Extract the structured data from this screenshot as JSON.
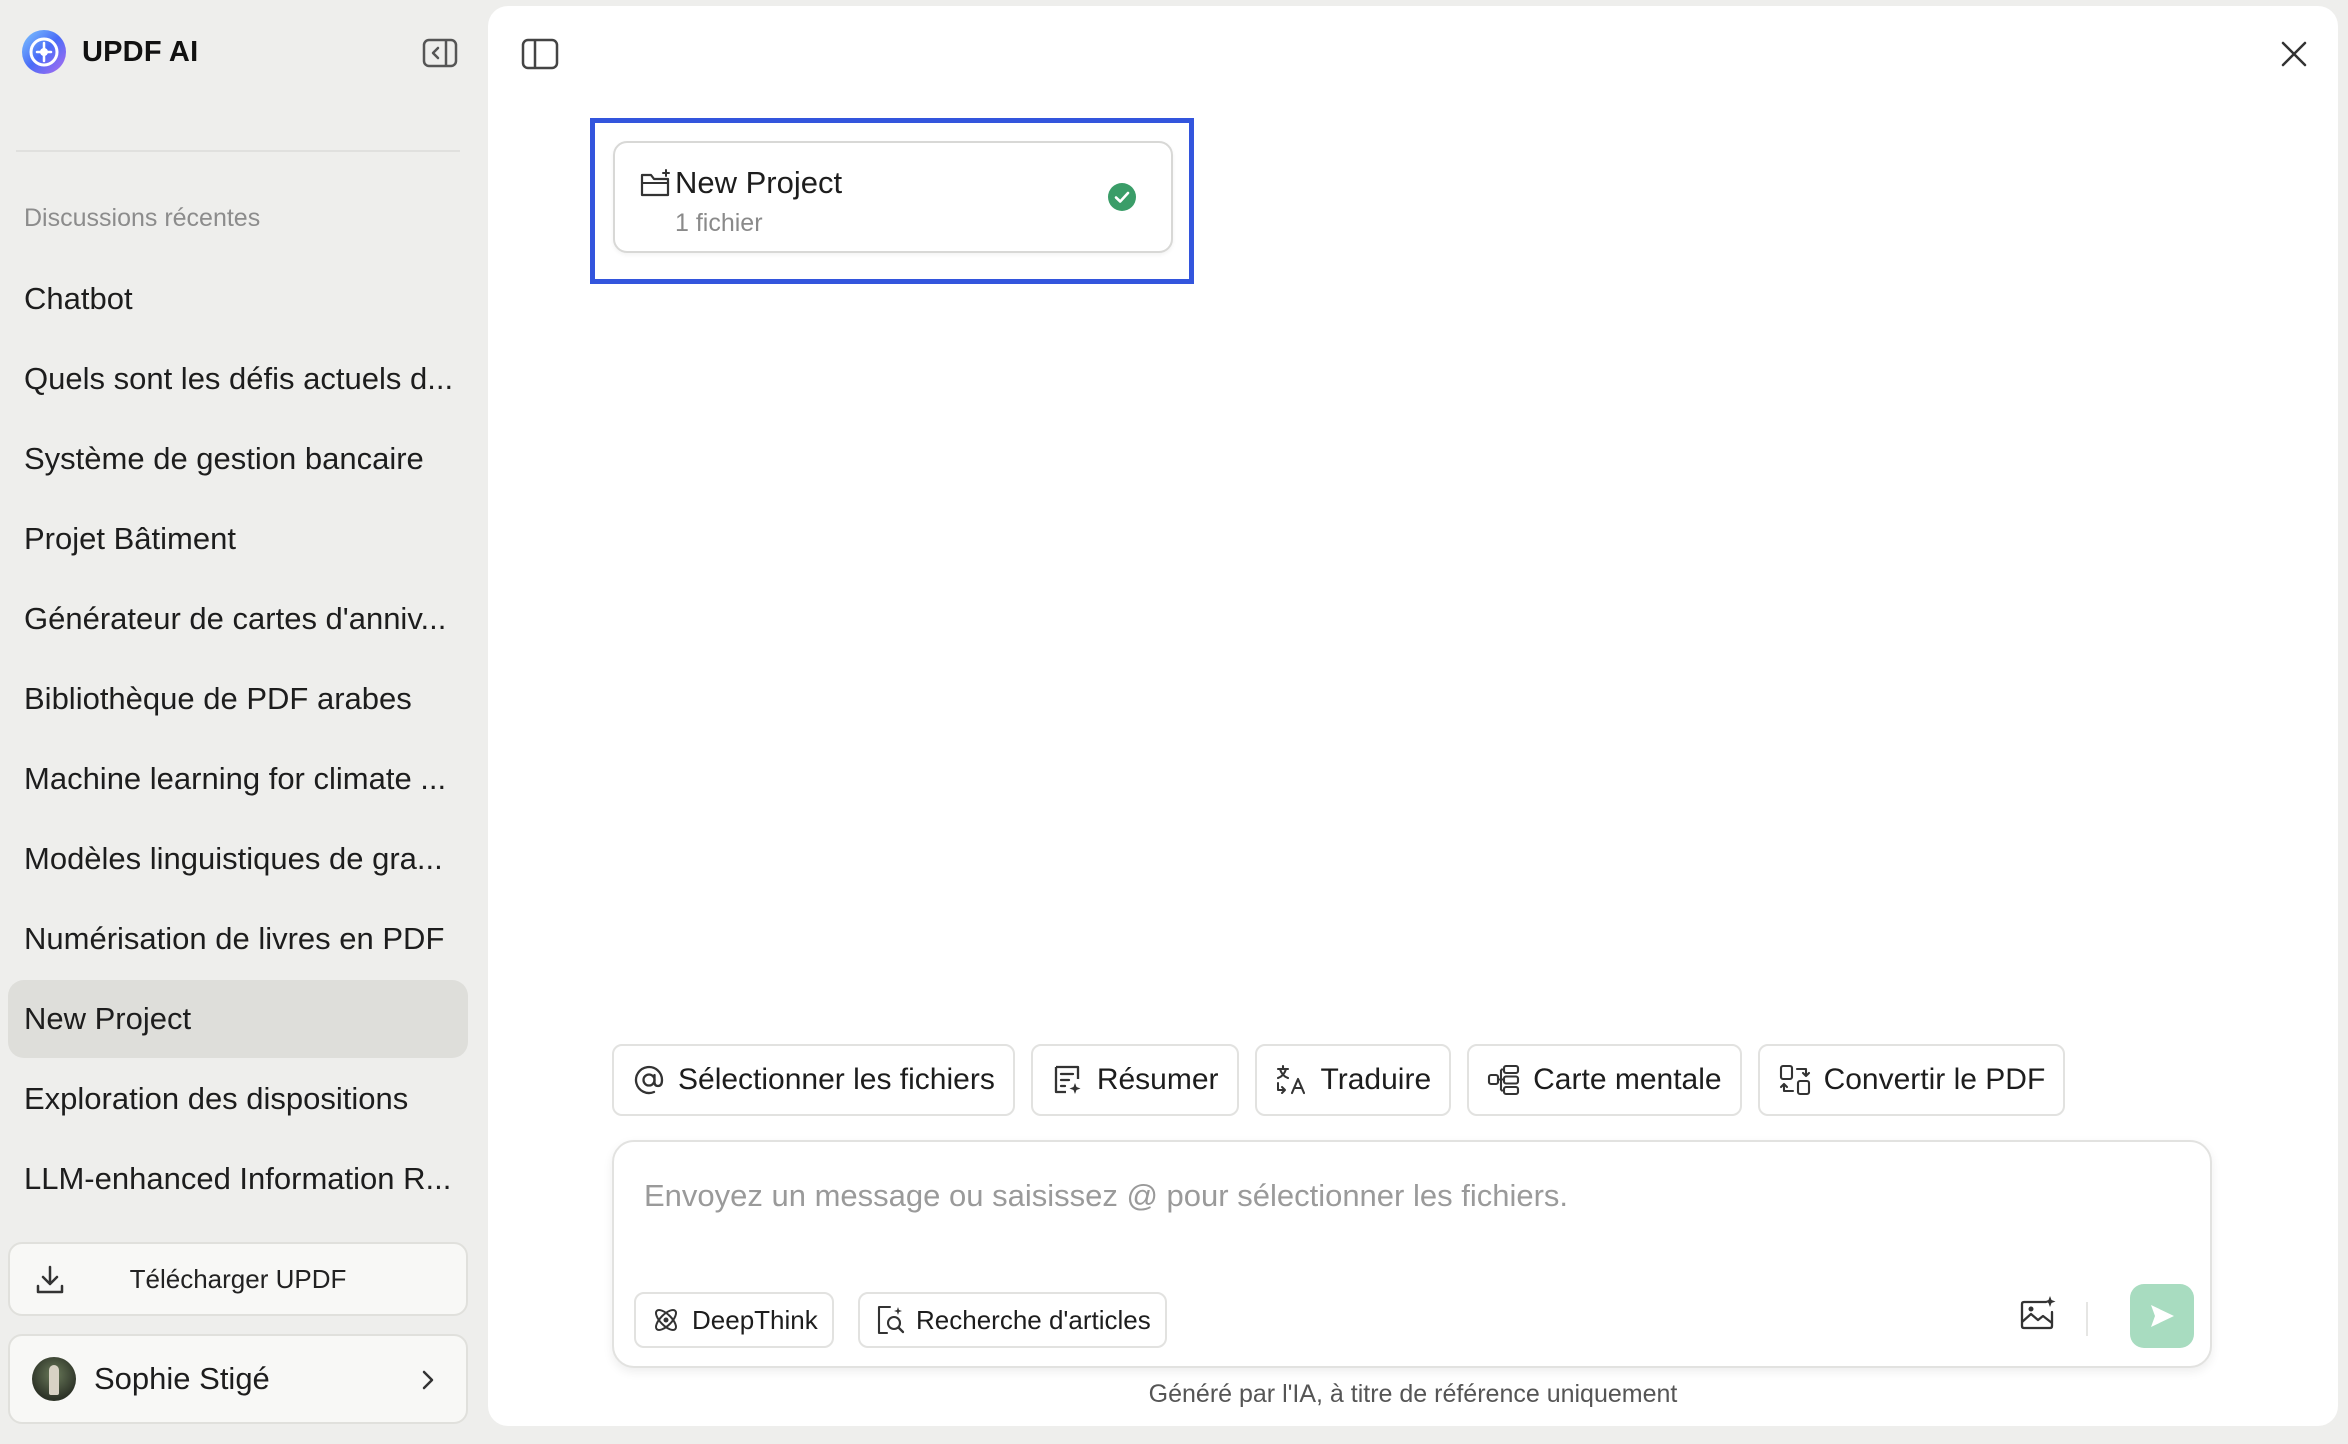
{
  "app": {
    "name": "UPDF AI"
  },
  "sidebar": {
    "section_label": "Discussions récentes",
    "items": [
      {
        "label": "Chatbot",
        "active": false
      },
      {
        "label": "Quels sont les défis actuels d...",
        "active": false
      },
      {
        "label": "Système de gestion bancaire",
        "active": false
      },
      {
        "label": "Projet Bâtiment",
        "active": false
      },
      {
        "label": "Générateur de cartes d'anniv...",
        "active": false
      },
      {
        "label": "Bibliothèque de PDF arabes",
        "active": false
      },
      {
        "label": "Machine learning for climate ...",
        "active": false
      },
      {
        "label": "Modèles linguistiques de gra...",
        "active": false
      },
      {
        "label": "Numérisation de livres en PDF",
        "active": false
      },
      {
        "label": "New Project",
        "active": true
      },
      {
        "label": "Exploration des dispositions",
        "active": false
      },
      {
        "label": "LLM-enhanced Information R...",
        "active": false
      }
    ],
    "download_label": "Télécharger UPDF",
    "user": {
      "name": "Sophie Stigé"
    }
  },
  "project_card": {
    "title": "New Project",
    "subtitle": "1 fichier",
    "status": "selected"
  },
  "quick_actions": [
    {
      "label": "Sélectionner les fichiers",
      "icon": "at-icon"
    },
    {
      "label": "Résumer",
      "icon": "summarize-icon"
    },
    {
      "label": "Traduire",
      "icon": "translate-icon"
    },
    {
      "label": "Carte mentale",
      "icon": "mindmap-icon"
    },
    {
      "label": "Convertir le PDF",
      "icon": "convert-icon"
    }
  ],
  "composer": {
    "placeholder": "Envoyez un message ou saisissez @ pour sélectionner les fichiers.",
    "value": "",
    "deepthink_label": "DeepThink",
    "research_label": "Recherche d'articles"
  },
  "footer": {
    "disclaimer": "Généré par l'IA, à titre de référence uniquement"
  },
  "colors": {
    "accent_highlight": "#3355dd",
    "success_check": "#3a9d68",
    "send_button": "#a8dcc0",
    "sidebar_bg": "#eeeeec",
    "active_item_bg": "#dededa"
  }
}
